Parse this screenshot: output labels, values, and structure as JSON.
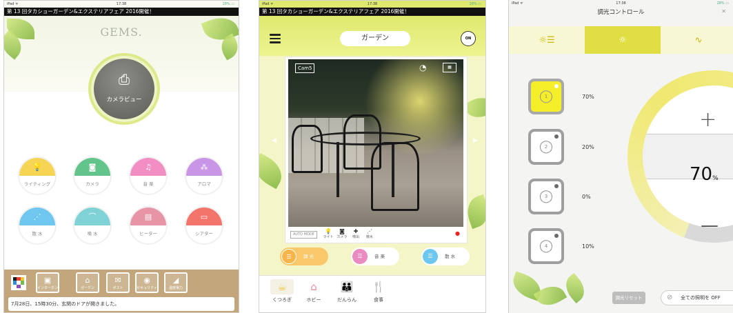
{
  "screen1": {
    "status": {
      "left": "iPad ᯤ",
      "time": "17:38",
      "battery": "28% ▭"
    },
    "banner": "第 13 回タカショーガーデン&エクステリアフェア 2016開催！",
    "logo": "GEMS.",
    "camera_label": "カメラビュー",
    "categories": [
      {
        "label": "ライティング",
        "icon": "bulb-icon",
        "glyph": "💡",
        "color": "#f7d554"
      },
      {
        "label": "カメラ",
        "icon": "camera-icon",
        "glyph": "◙",
        "color": "#62c48a"
      },
      {
        "label": "音 楽",
        "icon": "music-icon",
        "glyph": "♫",
        "color": "#f28ec3"
      },
      {
        "label": "アロマ",
        "icon": "aroma-icon",
        "glyph": "⁂",
        "color": "#c995e6"
      },
      {
        "label": "散 水",
        "icon": "sprinkle-icon",
        "glyph": "⋰",
        "color": "#6fc7f0"
      },
      {
        "label": "噴 水",
        "icon": "fountain-icon",
        "glyph": "⌒",
        "color": "#7fd2d5"
      },
      {
        "label": "ヒーター",
        "icon": "heater-icon",
        "glyph": "▤",
        "color": "#e794a6"
      },
      {
        "label": "シアター",
        "icon": "theater-icon",
        "glyph": "▭",
        "color": "#f2746a"
      }
    ],
    "toolbar": [
      {
        "label": "インターホン",
        "glyph": "▣"
      },
      {
        "label": "ガーデン",
        "glyph": "⌂"
      },
      {
        "label": "ポスト",
        "glyph": "✉"
      },
      {
        "label": "セキュリティ",
        "glyph": "◉"
      },
      {
        "label": "温度電力",
        "glyph": "◢"
      }
    ],
    "message": "7月28日、15時30分、玄関のドアが開きました。"
  },
  "screen2": {
    "status": {
      "left": "iPad ᯤ",
      "time": "17:38",
      "battery": "28% ▭"
    },
    "banner": "第 13 回タカショーガーデン&エクステリアフェア 2016開催！",
    "title": "ガーデン",
    "on_label": "ON",
    "cam_label": "Cam5",
    "auto_mode": "AUTO MODE",
    "controls": [
      {
        "label": "ライト",
        "glyph": "💡"
      },
      {
        "label": "カメラ",
        "glyph": "◙"
      },
      {
        "label": "噴出",
        "glyph": "✚"
      },
      {
        "label": "散水",
        "glyph": "⋰"
      }
    ],
    "rec": "●",
    "modes": [
      {
        "label": "調 光",
        "glyph": "☰",
        "color": "#f7b64c"
      },
      {
        "label": "音 楽",
        "glyph": "☰",
        "color": "#e98ac0"
      },
      {
        "label": "散 水",
        "glyph": "☰",
        "color": "#6fc7f0"
      }
    ],
    "bottom": [
      {
        "label": "くつろぎ",
        "glyph": "☕",
        "color": "#f3c33c"
      },
      {
        "label": "ホビー",
        "glyph": "⌂",
        "color": "#ee8b9a"
      },
      {
        "label": "だんらん",
        "glyph": "👪",
        "color": "#66b75c"
      },
      {
        "label": "食事",
        "glyph": "🍴",
        "color": "#e0a25c"
      }
    ]
  },
  "screen3": {
    "status": {
      "left": "iPad ᯤ",
      "time": "17:38",
      "battery": "28% ▭"
    },
    "title": "調光コントロール",
    "close": "✕",
    "tabs": [
      {
        "glyph": "☼☰",
        "name": "tab-list"
      },
      {
        "glyph": "☼",
        "name": "tab-dimmer"
      },
      {
        "glyph": "∿",
        "name": "tab-wave"
      }
    ],
    "bulbs": [
      {
        "number": "1",
        "percent": "70%",
        "on": true
      },
      {
        "number": "2",
        "percent": "20%",
        "on": false
      },
      {
        "number": "3",
        "percent": "0%",
        "on": false
      },
      {
        "number": "4",
        "percent": "10%",
        "on": false
      }
    ],
    "dial_level": 70,
    "dial_value": "70",
    "dial_unit": "%",
    "plus": "+",
    "minus": "—",
    "reset_label": "調光リセット",
    "alloff_label": "全ての照明を OFF"
  }
}
